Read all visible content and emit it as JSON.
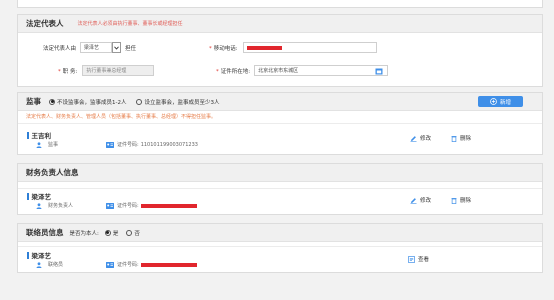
{
  "legal_rep": {
    "title": "法定代表人",
    "hint": "法定代表人必须由执行董事、董事长或经理担任",
    "from_label": "法定代表人由",
    "from_value": "梁泽艺",
    "serve_label": "担任",
    "phone_label": "移动电话:",
    "position_label": "职 务:",
    "position_value": "执行董事兼总经理",
    "id_location_label": "证件所在地:",
    "id_location_value": "北京北京市东城区"
  },
  "supervisor": {
    "title": "监事",
    "option_1": "不设监事会，监事成员1-2人",
    "option_2": "设立监事会，监事成员至少3人",
    "add_label": "新增",
    "tip": "法定代表人、财务负责人、管理人员（包括董事、执行董事、总经理）不得担任监事。",
    "person": {
      "name": "王吉利",
      "role": "监事",
      "id_label": "证件号码:",
      "id_value": "110101199003071233"
    },
    "edit_label": "修改",
    "delete_label": "删除"
  },
  "finance": {
    "title": "财务负责人信息",
    "person": {
      "name": "梁泽艺",
      "role": "财务负责人",
      "id_label": "证件号码:"
    },
    "edit_label": "修改",
    "delete_label": "删除"
  },
  "contact": {
    "title": "联络员信息",
    "self_label": "是否为本人:",
    "yes_label": "是",
    "no_label": "否",
    "person": {
      "name": "梁泽艺",
      "role": "联络员",
      "id_label": "证件号码:"
    },
    "view_label": "查看"
  },
  "colors": {
    "accent": "#3f8fe8",
    "required": "#e0362f",
    "redact": "#e1262d",
    "hint": "#e67a45"
  }
}
